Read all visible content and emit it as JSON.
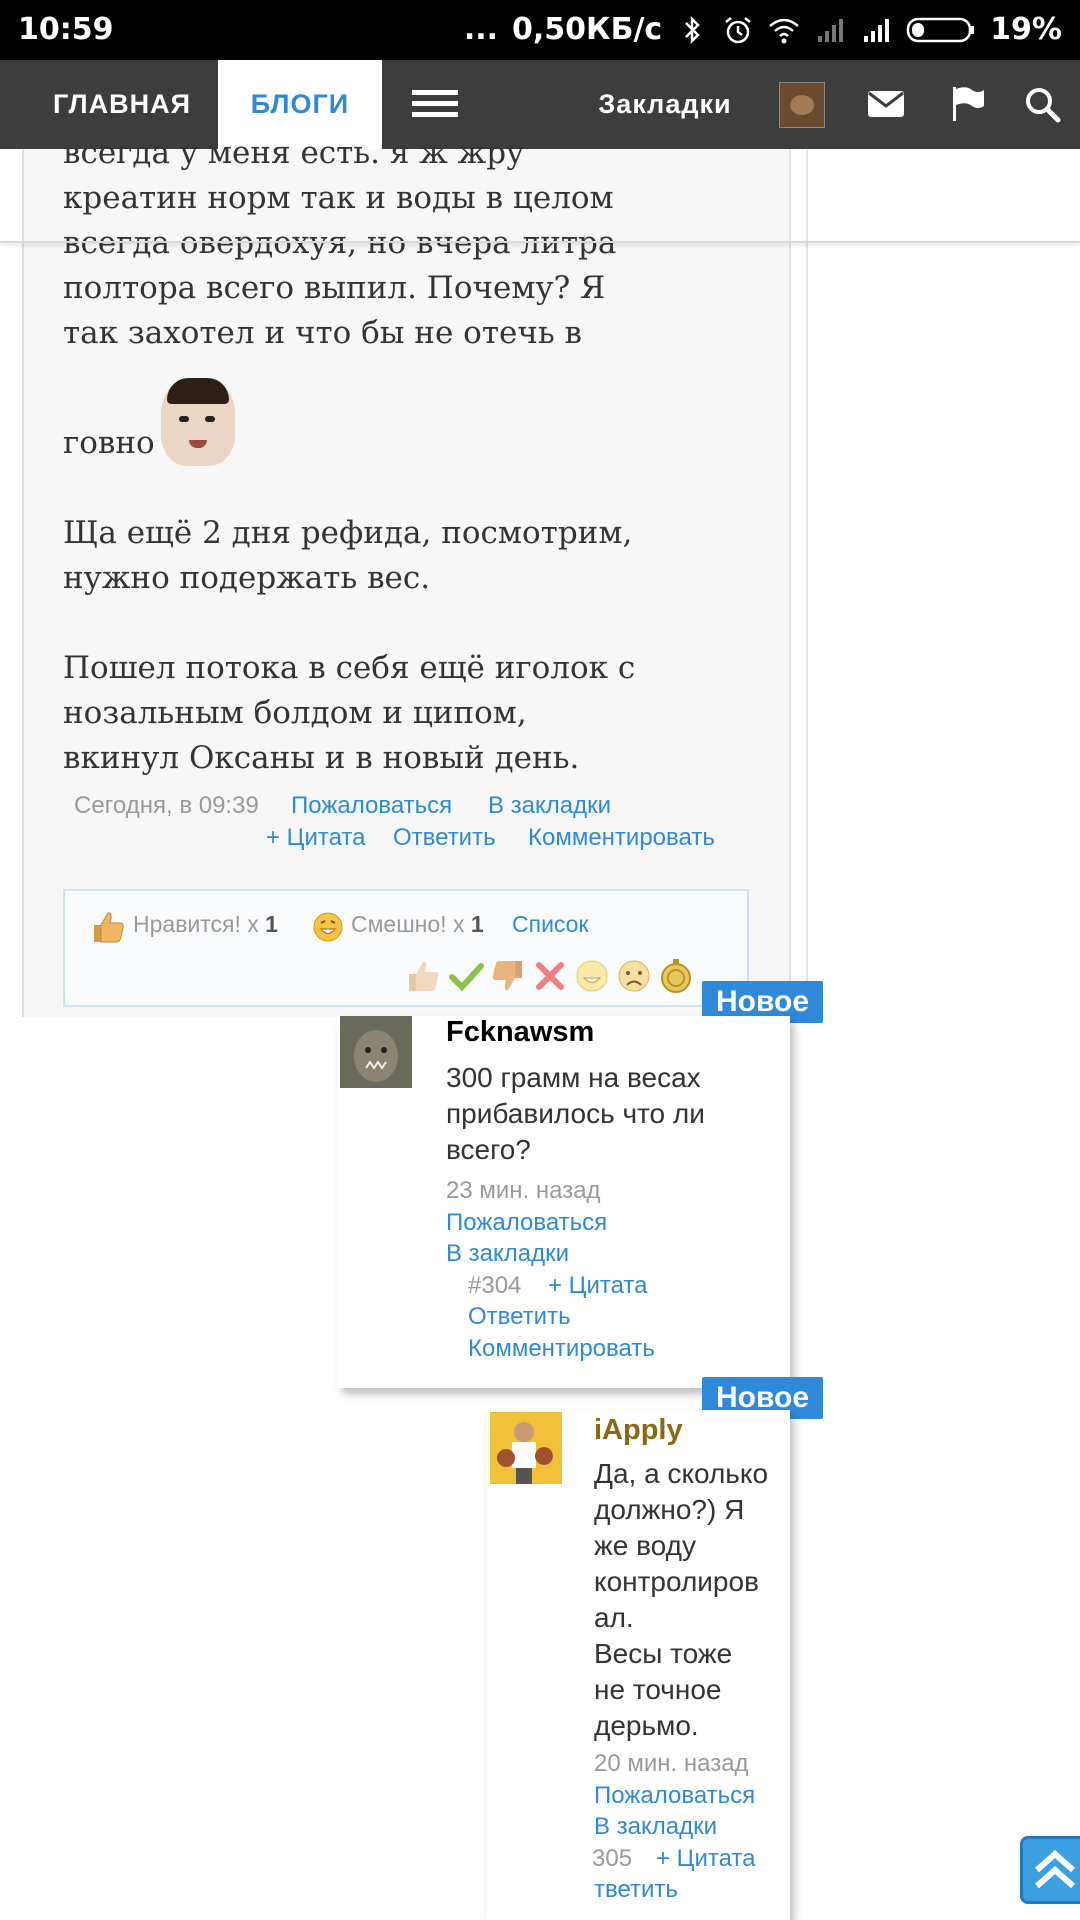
{
  "status_bar": {
    "time": "10:59",
    "dots": "...",
    "net_speed": "0,50КБ/с",
    "battery": "19%",
    "icons": [
      "bluetooth-icon",
      "alarm-icon",
      "wifi-icon",
      "signal-icon",
      "signal-icon",
      "battery-icon"
    ]
  },
  "nav": {
    "home": "ГЛАВНАЯ",
    "blogs": "БЛОГИ",
    "bookmarks": "Закладки",
    "icons": [
      "menu-icon",
      "avatar",
      "mail-icon",
      "flag-icon",
      "search-icon"
    ]
  },
  "post": {
    "lines": [
      "всегда у меня есть. я ж жру",
      "креатин норм так и воды в целом",
      "всегда овердохуя, но вчера литра",
      "полтора всего выпил. Почему? Я",
      "так захотел и что бы не отечь в"
    ],
    "line_emoji": "говно",
    "para2": [
      "Ща ещё 2 дня рефида, посмотрим,",
      "нужно подержать вес."
    ],
    "para3": [
      "Пошел потока в себя ещё иголок с",
      "нозальным болдом и ципом,",
      "вкинул Оксаны и в новый день."
    ],
    "date": "Сегодня, в 09:39",
    "report": "Пожаловаться",
    "bookmark": "В закладки",
    "quote": "+ Цитата",
    "reply": "Ответить",
    "comment": "Комментировать"
  },
  "likes": {
    "like_label": "Нравится! x",
    "like_count": "1",
    "funny_label": "Смешно! x",
    "funny_count": "1",
    "list": "Список"
  },
  "comments": [
    {
      "badge": "Новое",
      "author": "Fcknawsm",
      "author_color": "#111111",
      "text": [
        "300 грамм на весах",
        "прибавилось что ли",
        "всего?"
      ],
      "time": "23 мин. назад",
      "report": "Пожаловаться",
      "bookmark": "В закладки",
      "number": "#304",
      "quote": "+ Цитата",
      "reply": "Ответить",
      "comment": "Комментировать"
    },
    {
      "badge": "Новое",
      "author": "iApply",
      "author_color": "#8a6914",
      "text": [
        "Да, а сколько",
        "должно?) Я",
        "же воду",
        "контролиров",
        "ал.",
        "Весы тоже",
        "не точное",
        "дерьмо."
      ],
      "time": "20 мин. назад",
      "report": "Пожаловаться",
      "bookmark": "В закладки",
      "number": "305",
      "quote": "+ Цитата",
      "reply": "тветить"
    }
  ],
  "colors": {
    "accent": "#2e8ad8",
    "nav_bg": "#3d3d3d",
    "badge_bg": "#2e8ad8"
  }
}
